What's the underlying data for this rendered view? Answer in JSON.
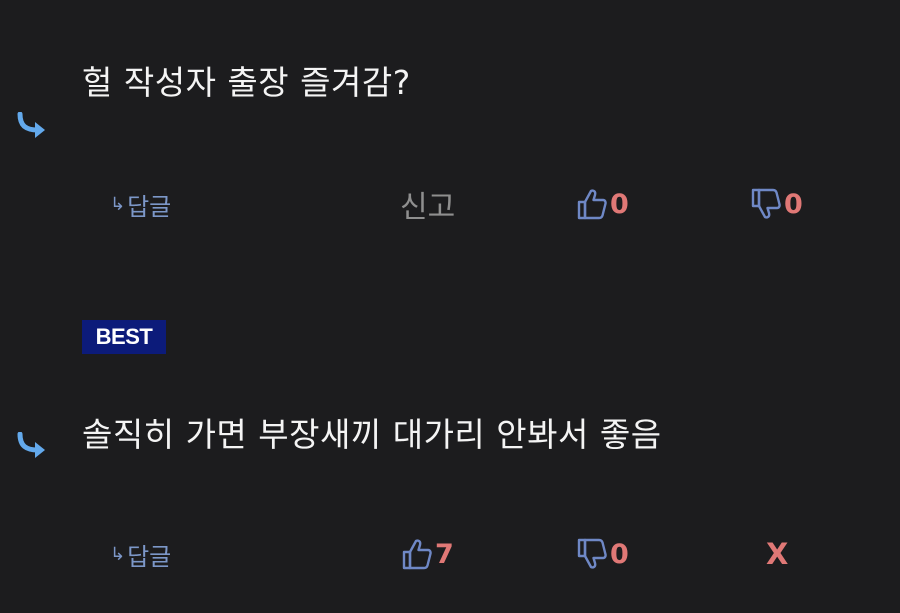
{
  "comments": [
    {
      "text": "헐 작성자 출장 즐겨감?",
      "reply_label": "답글",
      "reply_arrow": "↳",
      "report_label": "신고",
      "like_count": "0",
      "dislike_count": "0"
    },
    {
      "badge": "BEST",
      "text": "솔직히 가면 부장새끼 대가리 안봐서 좋음",
      "reply_label": "답글",
      "reply_arrow": "↳",
      "like_count": "7",
      "dislike_count": "0",
      "delete_label": "X"
    }
  ],
  "colors": {
    "background": "#1c1c1e",
    "reply_arrow_blue": "#63a9ec",
    "icon_blue": "#6f88c6",
    "count_red": "#e07876",
    "badge_bg": "#0c1b7a"
  },
  "icons": {
    "reply": "reply-arrow-icon",
    "like": "thumbs-up-icon",
    "dislike": "thumbs-down-icon"
  }
}
